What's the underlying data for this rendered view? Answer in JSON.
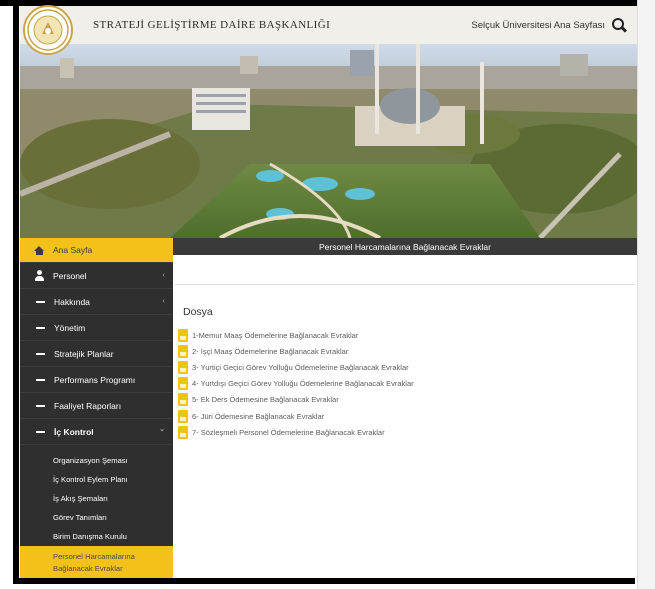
{
  "header": {
    "title": "STRATEJİ GELİŞTİRME DAİRE BAŞKANLIĞI",
    "home_link": "Selçuk Üniversitesi Ana Sayfası",
    "logo_text": "SELÇUK ÜNİVERSİTESİ · KONYA · 1975"
  },
  "sidebar": {
    "home": "Ana Sayfa",
    "items": [
      {
        "label": "Personel",
        "has_chevron": true
      },
      {
        "label": "Hakkında",
        "has_chevron": true
      },
      {
        "label": "Yönetim",
        "has_chevron": false
      },
      {
        "label": "Stratejik Planlar",
        "has_chevron": false
      },
      {
        "label": "Performans Programı",
        "has_chevron": false
      },
      {
        "label": "Faaliyet Raporları",
        "has_chevron": false
      },
      {
        "label": "İç Kontrol",
        "has_chevron": true
      }
    ],
    "sub_items": [
      "Organizasyon Şeması",
      "İç Kontrol Eylem Planı",
      "İş Akış Şemaları",
      "Görev Tanımları",
      "Birim Danışma Kurulu"
    ],
    "active_sub": "Personel Harcamalarına Bağlanacak Evraklar",
    "chevron_left": "‹",
    "chevron_down": "⌄"
  },
  "main": {
    "page_title": "Personel Harcamalarına Bağlanacak Evraklar",
    "section_title": "Dosya",
    "files": [
      "1-Memur Maaş Ödemelerine Bağlanacak Evraklar",
      "2- İşçi Maaş Ödemelerine Bağlanacak Evraklar",
      "3- Yurtiçi Geçici Görev Yolluğu Ödemelerine Bağlanacak Evraklar",
      "4- Yurtdışı Geçici Görev Yolluğu Ödemelerine Bağlanacak Evraklar",
      "5- Ek Ders Ödemesine Bağlanacak Evraklar",
      "6- Jüri Ödemesine Bağlanacak Evraklar",
      "7- Sözleşmeli Personel Ödemelerine Bağlanacak Evraklar"
    ]
  },
  "colors": {
    "accent": "#f2c21b",
    "sidebar_bg": "#2f2f2f",
    "title_bar": "#3a3a3a"
  }
}
